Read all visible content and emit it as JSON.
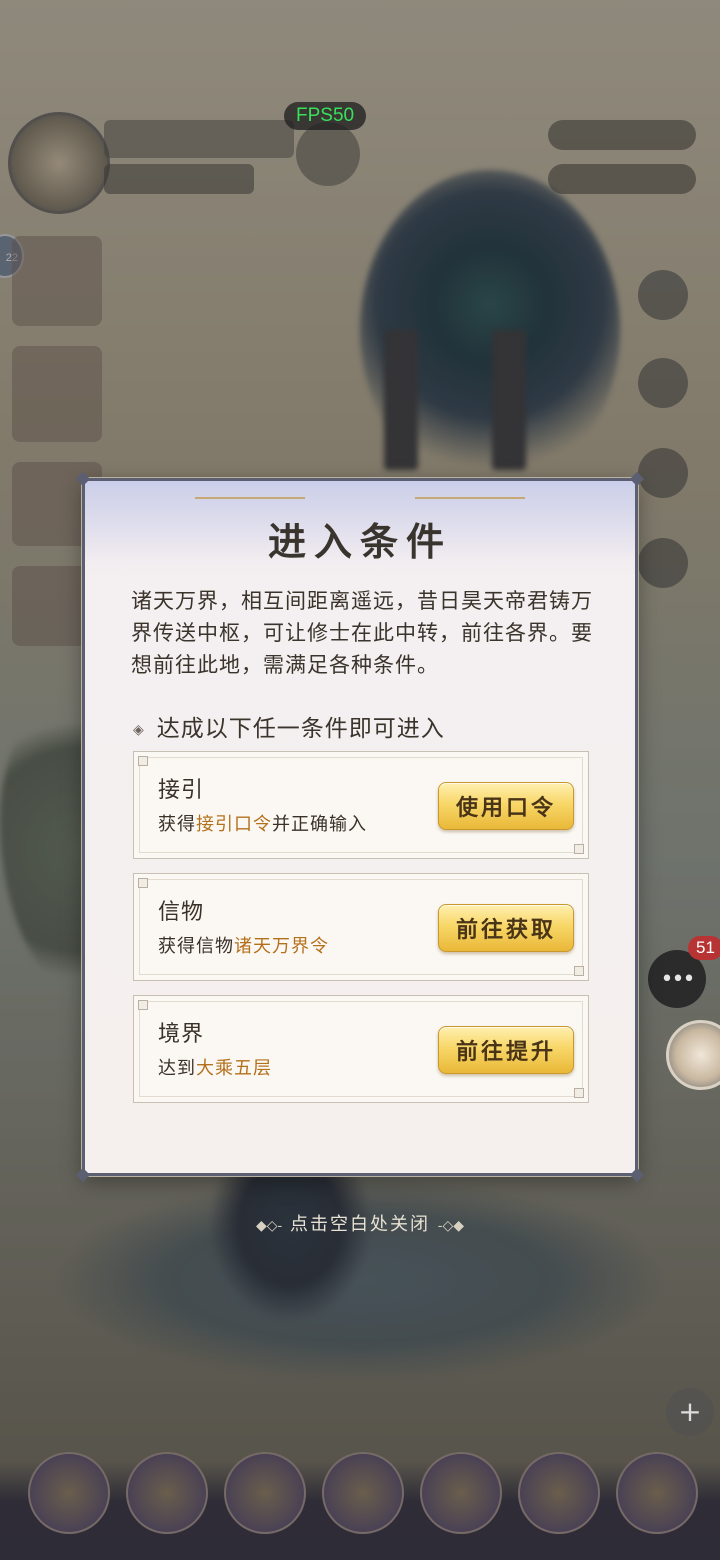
{
  "hud": {
    "fps_label": "FPS50",
    "side_badge": "22",
    "chat_count": "51"
  },
  "dialog": {
    "title": "进入条件",
    "description": "诸天万界，相互间距离遥远，昔日昊天帝君铸万界传送中枢，可让修士在此中转，前往各界。要想前往此地，需满足各种条件。",
    "conditions_header": "达成以下任一条件即可进入",
    "conditions": [
      {
        "name": "接引",
        "prefix": "获得",
        "highlight": "接引口令",
        "suffix": "并正确输入",
        "button": "使用口令"
      },
      {
        "name": "信物",
        "prefix": "获得信物",
        "highlight": "诸天万界令",
        "suffix": "",
        "button": "前往获取"
      },
      {
        "name": "境界",
        "prefix": "达到",
        "highlight": "大乘五层",
        "suffix": "",
        "button": "前往提升"
      }
    ]
  },
  "close_hint": "点击空白处关闭",
  "icons": [
    "chat-icon",
    "plus-icon",
    "avatar"
  ],
  "colors": {
    "highlight": "#b4711c",
    "button_gold": "#f8d768",
    "fps_green": "#39e05a",
    "badge_red": "#b83434"
  }
}
